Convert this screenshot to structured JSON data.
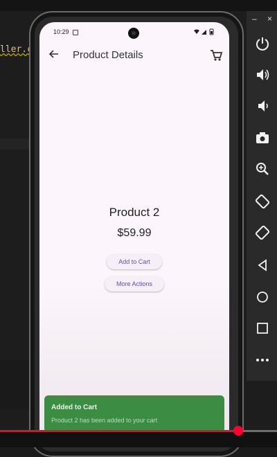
{
  "editor": {
    "code_fragment": "ller.c"
  },
  "status_bar": {
    "time": "10:29"
  },
  "app_bar": {
    "title": "Product Details"
  },
  "product": {
    "name": "Product 2",
    "price": "$59.99"
  },
  "actions": {
    "add_to_cart": "Add to Cart",
    "more_actions": "More Actions"
  },
  "snackbar": {
    "title": "Added to Cart",
    "message": "Product 2 has been added to your cart",
    "color": "#3b8d44"
  },
  "emulator_controls": {
    "close": "×",
    "minimize": "–",
    "icons": [
      "power-icon",
      "volume-up-icon",
      "volume-down-icon",
      "camera-icon",
      "zoom-in-icon",
      "rotate-left-icon",
      "rotate-right-icon",
      "back-icon",
      "home-icon",
      "overview-icon",
      "more-icon"
    ]
  },
  "video": {
    "progress_fraction": 0.86,
    "accent": "#ff0033"
  }
}
